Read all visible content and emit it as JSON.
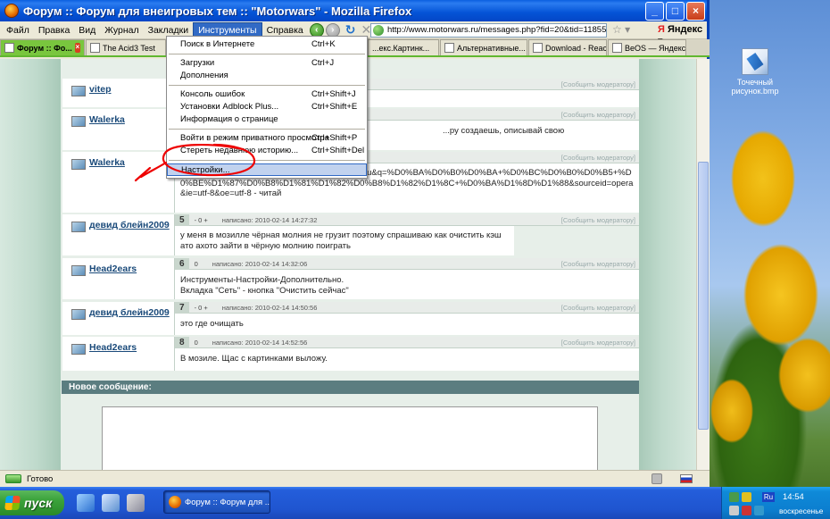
{
  "window": {
    "title": "Форум :: Форум для внеигровых тем :: \"Motorwars\" - Mozilla Firefox"
  },
  "menubar": {
    "items": [
      "Файл",
      "Правка",
      "Вид",
      "Журнал",
      "Закладки",
      "Инструменты",
      "Справка"
    ],
    "active_index": 5
  },
  "toolbar": {
    "url": "http://www.motorwars.ru/messages.php?fid=20&tid=11855&page_id=",
    "search_engine": "Яндекс"
  },
  "tabs": [
    {
      "label": "Форум :: Фо...",
      "active": true
    },
    {
      "label": "The Acid3 Test",
      "active": false
    },
    {
      "label": "...екс.Картинк...",
      "active": false
    },
    {
      "label": "Альтернативные...",
      "active": false
    },
    {
      "label": "Download - React...",
      "active": false
    },
    {
      "label": "BeOS — Яндекс: ...",
      "active": false
    }
  ],
  "dropdown": {
    "groups": [
      [
        {
          "label": "Поиск в Интернете",
          "key": "Ctrl+K"
        }
      ],
      [
        {
          "label": "Загрузки",
          "key": "Ctrl+J"
        },
        {
          "label": "Дополнения",
          "key": ""
        }
      ],
      [
        {
          "label": "Консоль ошибок",
          "key": "Ctrl+Shift+J"
        },
        {
          "label": "Установки Adblock Plus...",
          "key": "Ctrl+Shift+E"
        },
        {
          "label": "Информация о странице",
          "key": ""
        }
      ],
      [
        {
          "label": "Войти в режим приватного просмотра",
          "key": "Ctrl+Shift+P"
        },
        {
          "label": "Стереть недавнюю историю...",
          "key": "Ctrl+Shift+Del"
        }
      ],
      [
        {
          "label": "Настройки...",
          "key": ""
        }
      ]
    ],
    "highlighted": "Настройки..."
  },
  "posts": [
    {
      "author": "vitep",
      "num": "",
      "rate": "",
      "date": "",
      "report": "[Сообщить модератору]",
      "body": ""
    },
    {
      "author": "Walerka",
      "num": "",
      "rate": "",
      "date": "",
      "report": "[Сообщить модератору]",
      "body": "...ру создаешь, описывай свою"
    },
    {
      "author": "Walerka",
      "num": "",
      "rate": "",
      "date": "",
      "report": "[Сообщить модератору]",
      "body": "http://www.google.com/search?client=opera&rls=ru&q=%D0%BA%D0%B0%D0%BA+%D0%BC%D0%B0%D0%B5+%D0%BE%D1%87%D0%B8%D1%81%D1%82%D0%B8%D1%82%D1%8C+%D0%BA%D1%8D%D1%88&sourceid=opera&ie=utf-8&oe=utf-8 - читай"
    },
    {
      "author": "девид блейн2009",
      "num": "5",
      "rate": "- 0 +",
      "date": "написано: 2010-02-14 14:27:32",
      "report": "[Сообщить модератору]",
      "body": "у меня в мозилле чёрная молния не грузит поэтому спрашиваю как очистить кэш ато ахото зайти в чёрную молнию поиграть"
    },
    {
      "author": "Head2ears",
      "num": "6",
      "rate": "0",
      "date": "написано: 2010-02-14 14:32:06",
      "report": "[Сообщить модератору]",
      "body": "Инструменты-Настройки-Дополнительно.\nВкладка \"Сеть\" - кнопка \"Очистить сейчас\""
    },
    {
      "author": "девид блейн2009",
      "num": "7",
      "rate": "- 0 +",
      "date": "написано: 2010-02-14 14:50:56",
      "report": "[Сообщить модератору]",
      "body": "это где очищать"
    },
    {
      "author": "Head2ears",
      "num": "8",
      "rate": "0",
      "date": "написано: 2010-02-14 14:52:56",
      "report": "[Сообщить модератору]",
      "body": "В мозиле. Щас с картинками выложу."
    }
  ],
  "new_message": {
    "label": "Новое сообщение:"
  },
  "statusbar": {
    "text": "Готово"
  },
  "desktop": {
    "icon_label": "Точечный рисунок.bmp"
  },
  "taskbar": {
    "start_label": "пуск",
    "task_label": "Форум :: Форум для ...",
    "lang": "Ru",
    "time": "14:54",
    "day": "воскресенье"
  }
}
